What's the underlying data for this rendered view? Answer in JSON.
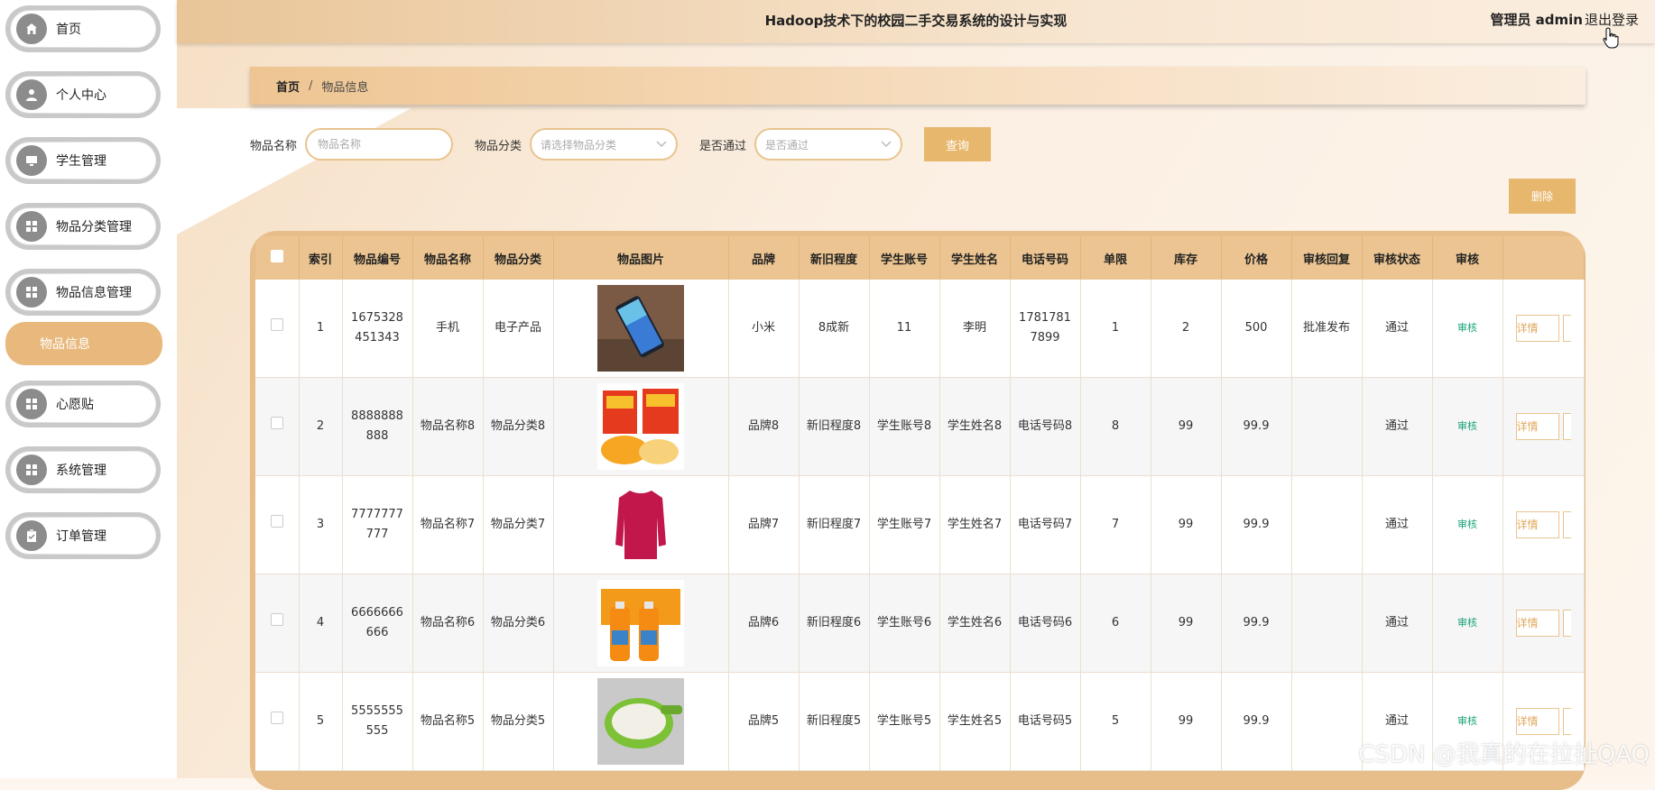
{
  "header": {
    "title": "Hadoop技术下的校园二手交易系统的设计与实现",
    "user": "管理员 admin",
    "logout": "退出登录"
  },
  "sidebar": {
    "items": [
      {
        "label": "首页",
        "icon": "home-icon"
      },
      {
        "label": "个人中心",
        "icon": "user-icon"
      },
      {
        "label": "学生管理",
        "icon": "monitor-icon"
      },
      {
        "label": "物品分类管理",
        "icon": "grid-icon"
      },
      {
        "label": "物品信息管理",
        "icon": "grid-icon"
      },
      {
        "label": "心愿贴",
        "icon": "grid-icon"
      },
      {
        "label": "系统管理",
        "icon": "grid-icon"
      },
      {
        "label": "订单管理",
        "icon": "clipboard-icon"
      }
    ],
    "active_sub": "物品信息"
  },
  "breadcrumb": {
    "home": "首页",
    "sep": "/",
    "current": "物品信息"
  },
  "search": {
    "name_label": "物品名称",
    "name_placeholder": "物品名称",
    "category_label": "物品分类",
    "category_placeholder": "请选择物品分类",
    "passed_label": "是否通过",
    "passed_placeholder": "是否通过",
    "query_button": "查询",
    "delete_button": "删除"
  },
  "table": {
    "columns": [
      "索引",
      "物品编号",
      "物品名称",
      "物品分类",
      "物品图片",
      "品牌",
      "新旧程度",
      "学生账号",
      "学生姓名",
      "电话号码",
      "单限",
      "库存",
      "价格",
      "审核回复",
      "审核状态",
      "审核"
    ],
    "audit_label": "审核",
    "detail_label": "详情",
    "rows": [
      {
        "idx": "1",
        "code": "1675328451343",
        "name": "手机",
        "cat": "电子产品",
        "brand": "小米",
        "cond": "8成新",
        "acct": "11",
        "sname": "李明",
        "phone": "17817817899",
        "limit": "1",
        "stock": "2",
        "price": "500",
        "reply": "批准发布",
        "status": "通过",
        "img": "phone"
      },
      {
        "idx": "2",
        "code": "8888888888",
        "name": "物品名称8",
        "cat": "物品分类8",
        "brand": "品牌8",
        "cond": "新旧程度8",
        "acct": "学生账号8",
        "sname": "学生姓名8",
        "phone": "电话号码8",
        "limit": "8",
        "stock": "99",
        "price": "99.9",
        "reply": "",
        "status": "通过",
        "img": "snacks"
      },
      {
        "idx": "3",
        "code": "7777777777",
        "name": "物品名称7",
        "cat": "物品分类7",
        "brand": "品牌7",
        "cond": "新旧程度7",
        "acct": "学生账号7",
        "sname": "学生姓名7",
        "phone": "电话号码7",
        "limit": "7",
        "stock": "99",
        "price": "99.9",
        "reply": "",
        "status": "通过",
        "img": "shirt"
      },
      {
        "idx": "4",
        "code": "6666666666",
        "name": "物品名称6",
        "cat": "物品分类6",
        "brand": "品牌6",
        "cond": "新旧程度6",
        "acct": "学生账号6",
        "sname": "学生姓名6",
        "phone": "电话号码6",
        "limit": "6",
        "stock": "99",
        "price": "99.9",
        "reply": "",
        "status": "通过",
        "img": "juice"
      },
      {
        "idx": "5",
        "code": "5555555555",
        "name": "物品名称5",
        "cat": "物品分类5",
        "brand": "品牌5",
        "cond": "新旧程度5",
        "acct": "学生账号5",
        "sname": "学生姓名5",
        "phone": "电话号码5",
        "limit": "5",
        "stock": "99",
        "price": "99.9",
        "reply": "",
        "status": "通过",
        "img": "basket"
      }
    ]
  },
  "watermark": "CSDN @我真的在拉扯QAQ",
  "colors": {
    "accent": "#e8b76e",
    "sidebar_active": "#e8b87c",
    "audit": "#1aa37a"
  }
}
